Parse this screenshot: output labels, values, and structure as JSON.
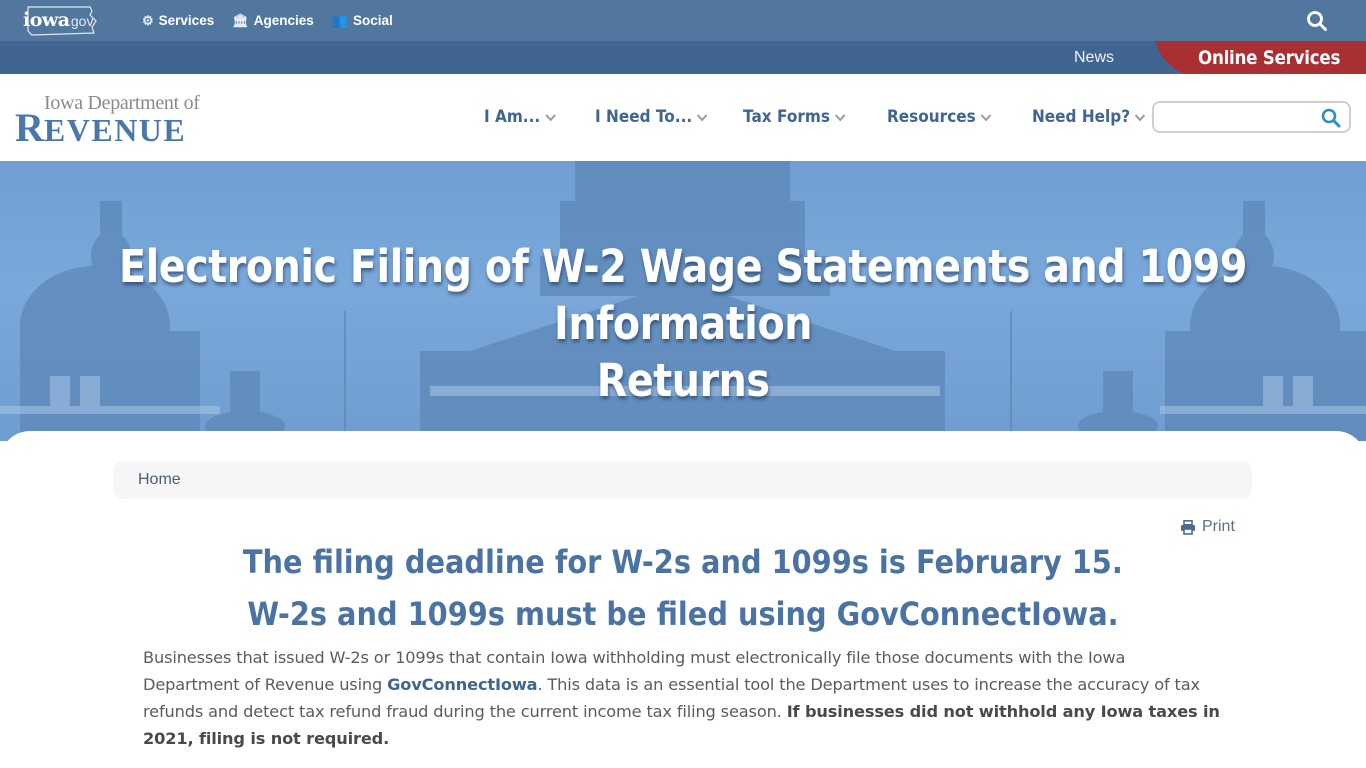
{
  "govbar": {
    "logo_main": "iowa",
    "logo_suffix": ".gov",
    "links": [
      {
        "label": "Services",
        "icon": "gears-icon"
      },
      {
        "label": "Agencies",
        "icon": "building-icon"
      },
      {
        "label": "Social",
        "icon": "users-icon"
      }
    ]
  },
  "subbar": {
    "news_label": "News",
    "online_services_label": "Online Services"
  },
  "header": {
    "logo_line1": "Iowa Department of",
    "logo_line2_initial": "R",
    "logo_line2_rest": "EVENUE",
    "nav": [
      {
        "label": "I Am..."
      },
      {
        "label": "I Need To..."
      },
      {
        "label": "Tax Forms"
      },
      {
        "label": "Resources"
      },
      {
        "label": "Need Help?"
      }
    ],
    "search_placeholder": "",
    "search_value": ""
  },
  "hero": {
    "title_line1": "Electronic Filing of W-2 Wage Statements and 1099 Information",
    "title_line2": "Returns"
  },
  "breadcrumb": {
    "items": [
      "Home"
    ]
  },
  "content": {
    "print_label": "Print",
    "headline1": "The filing deadline for W-2s and 1099s is February 15.",
    "headline2": "W-2s and 1099s must be filed using GovConnectIowa.",
    "para_part1": "Businesses that issued W-2s or 1099s that contain Iowa withholding must electronically file those documents with the Iowa Department of Revenue using ",
    "para_link": "GovConnectIowa",
    "para_part2": ". This data is an essential tool the Department uses to increase the accuracy of tax refunds and detect tax refund fraud during the current income tax filing season. ",
    "para_bold": "If businesses did not withhold any Iowa taxes in 2021, filing is not required."
  },
  "colors": {
    "govbar_bg": "#52779e",
    "subbar_bg": "#3f6590",
    "online_services_bg": "#a93032",
    "brand_blue": "#4a78ad",
    "nav_text": "#3f6590",
    "search_icon": "#2a8fc0"
  }
}
